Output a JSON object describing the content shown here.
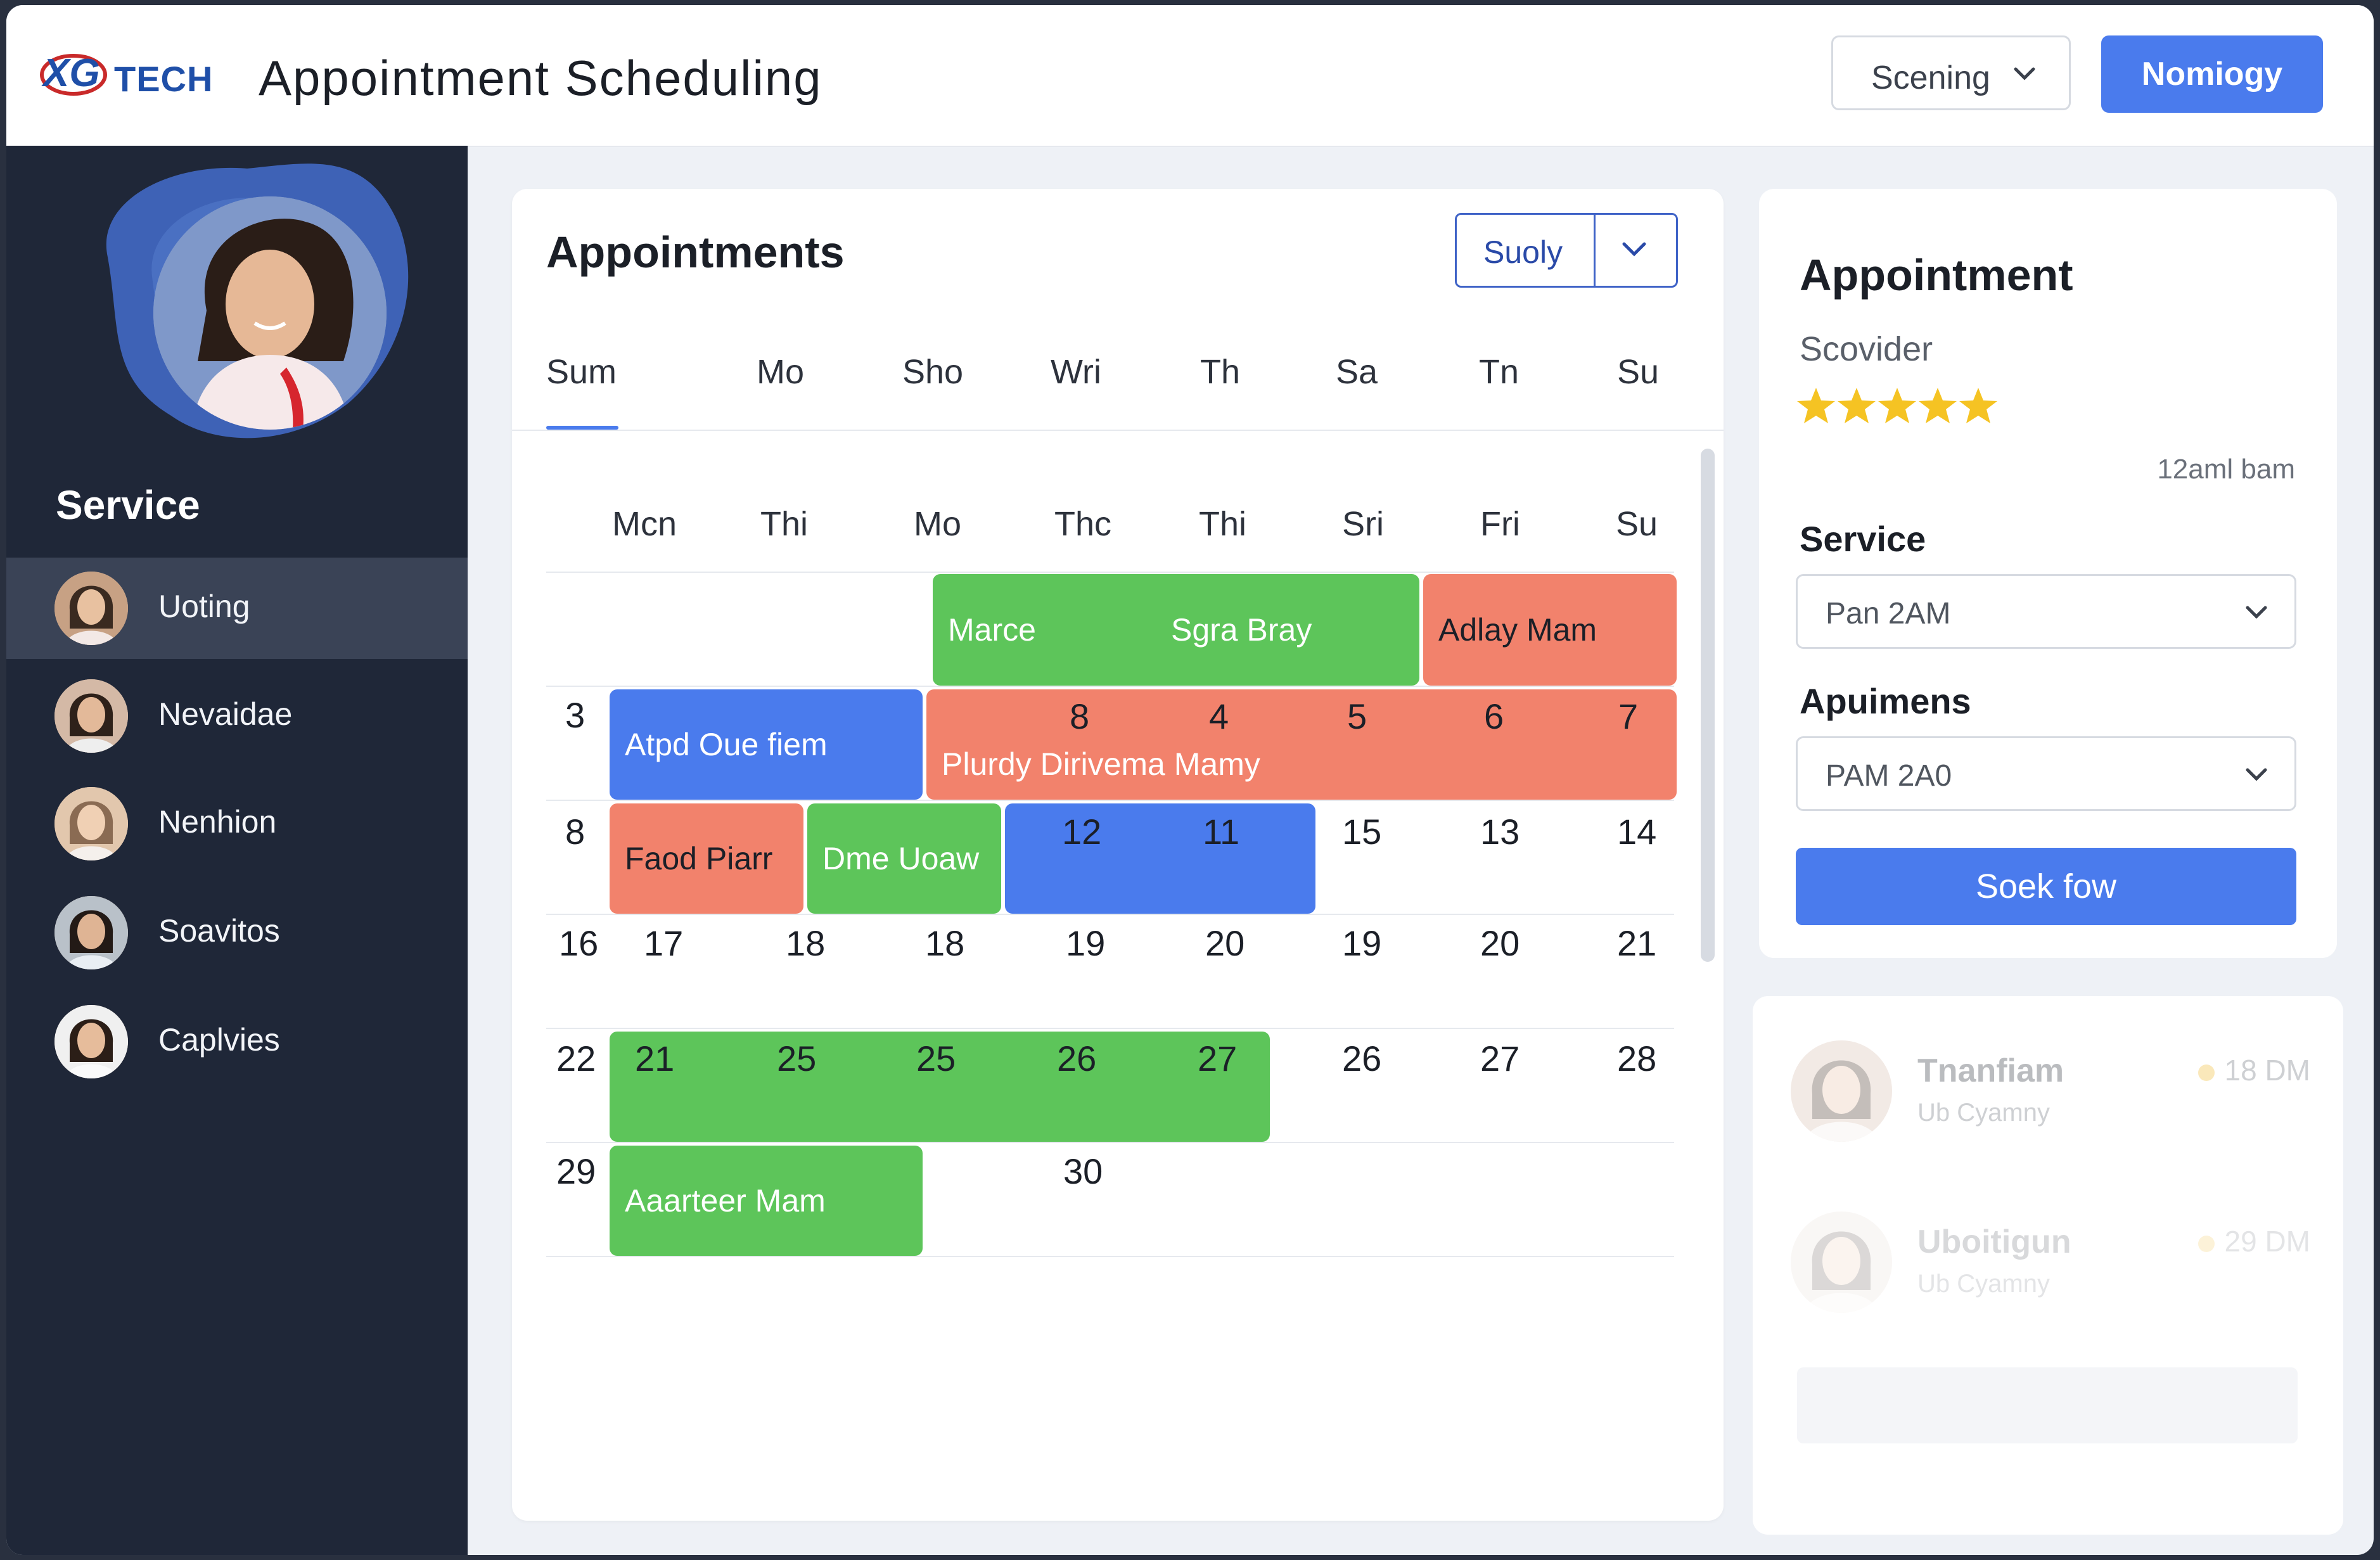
{
  "header": {
    "logo_text": "XG TECH",
    "title": "Appointment Scheduling",
    "select_label": "Scening",
    "primary_button": "Nomiogy"
  },
  "sidebar": {
    "title": "Service",
    "items": [
      {
        "label": "Uoting",
        "active": true
      },
      {
        "label": "Nevaidae",
        "active": false
      },
      {
        "label": "Nenhion",
        "active": false
      },
      {
        "label": "Soavitos",
        "active": false
      },
      {
        "label": "Caplvies",
        "active": false
      }
    ]
  },
  "calendar": {
    "title": "Appointments",
    "filter_label": "Suoly",
    "week_tabs": [
      "Sum",
      "Mo",
      "Sho",
      "Wri",
      "Th",
      "Sa",
      "Tn",
      "Su"
    ],
    "day_headers": [
      "Mcn",
      "Thi",
      "Mo",
      "Thc",
      "Thi",
      "Sri",
      "Fri",
      "Su"
    ],
    "rows": [
      [
        "",
        "",
        "",
        "",
        "",
        "",
        "",
        ""
      ],
      [
        "3",
        "",
        "",
        "8",
        "4",
        "5",
        "6",
        "7"
      ],
      [
        "8",
        "",
        "",
        "12",
        "11",
        "15",
        "13",
        "14"
      ],
      [
        "16",
        "17",
        "18",
        "18",
        "19",
        "20",
        "19",
        "20",
        "21"
      ],
      [
        "22",
        "21",
        "25",
        "25",
        "26",
        "27",
        "26",
        "27",
        "28"
      ],
      [
        "29",
        "",
        "",
        "30"
      ]
    ],
    "events": [
      {
        "label": "Marce",
        "color": "green"
      },
      {
        "label": "Sgra Bray",
        "color": "green"
      },
      {
        "label": "Adlay Mam",
        "color": "red"
      },
      {
        "label": "Atpd Oue fiem",
        "color": "blue"
      },
      {
        "label": "Plurdy Dirivema Mamy",
        "color": "red"
      },
      {
        "label": "Faod Piarr",
        "color": "red"
      },
      {
        "label": "Dme Uoaw",
        "color": "green"
      },
      {
        "label": "Aaarteer Mam",
        "color": "green"
      }
    ]
  },
  "booking": {
    "title": "Appointment",
    "provider": "Scovider",
    "rating": 5,
    "time": "12aml bam",
    "service_label": "Service",
    "service_value": "Pan 2AM",
    "appointments_label": "Apuimens",
    "appointments_value": "PAM 2A0",
    "button": "Soek fow"
  },
  "list": [
    {
      "name": "Tnanfiam",
      "sub": "Ub Cyamny",
      "time": "18 DM"
    },
    {
      "name": "Uboitigun",
      "sub": "Ub Cyamny",
      "time": "29 DM"
    }
  ],
  "colors": {
    "accent": "#4a7bed",
    "green": "#5dc55a",
    "red": "#f2826c",
    "sidebar": "#1f2738",
    "star": "#f5c323"
  }
}
